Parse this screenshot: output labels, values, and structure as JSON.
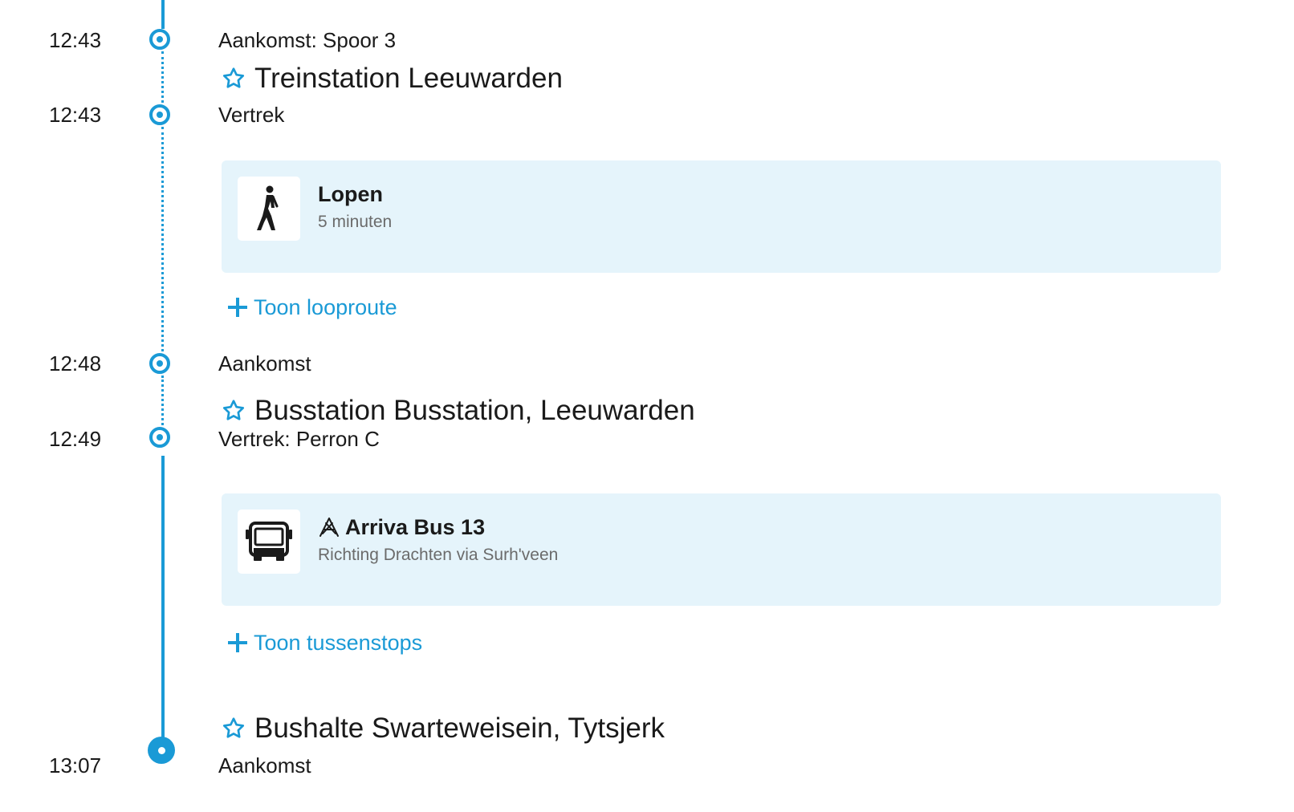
{
  "colors": {
    "accent": "#1a9ad6",
    "card_background": "#e5f4fb",
    "text": "#1a1a1a",
    "muted_text": "#6b6b6b"
  },
  "stops": [
    {
      "time": "12:43",
      "label": "Aankomst: Spoor 3"
    },
    {
      "station": "Treinstation Leeuwarden"
    },
    {
      "time": "12:43",
      "label": "Vertrek"
    },
    {
      "time": "12:48",
      "label": "Aankomst"
    },
    {
      "station": "Busstation Busstation, Leeuwarden"
    },
    {
      "time": "12:49",
      "label": "Vertrek: Perron C"
    },
    {
      "station": "Bushalte Swarteweisein, Tytsjerk"
    },
    {
      "time": "13:07",
      "label": "Aankomst"
    }
  ],
  "legs": [
    {
      "icon": "walking-icon",
      "title": "Lopen",
      "subtitle": "5 minuten",
      "toggle_label": "Toon looproute"
    },
    {
      "icon": "bus-icon",
      "operator_icon": "arriva-logo-icon",
      "title": "Arriva Bus 13",
      "subtitle": "Richting Drachten via Surh'veen",
      "toggle_label": "Toon tussenstops"
    }
  ]
}
